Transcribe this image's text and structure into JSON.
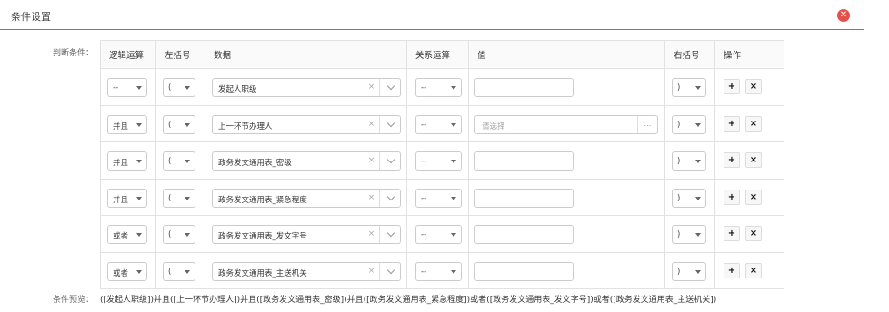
{
  "header": {
    "title": "条件设置",
    "close_icon": "✕"
  },
  "condition_label": "判断条件：",
  "columns": [
    "逻辑运算",
    "左括号",
    "数据",
    "关系运算",
    "值",
    "右括号",
    "操作"
  ],
  "rows": [
    {
      "logic": "--",
      "lparen": "(",
      "data": "发起人职级",
      "relation": "--",
      "value_type": "text",
      "value": "",
      "rparen": ")"
    },
    {
      "logic": "并且",
      "lparen": "(",
      "data": "上一环节办理人",
      "relation": "--",
      "value_type": "picker",
      "value": "请选择",
      "rparen": ")"
    },
    {
      "logic": "并且",
      "lparen": "(",
      "data": "政务发文通用表_密级",
      "relation": "--",
      "value_type": "text",
      "value": "",
      "rparen": ")"
    },
    {
      "logic": "并且",
      "lparen": "(",
      "data": "政务发文通用表_紧急程度",
      "relation": "--",
      "value_type": "text",
      "value": "",
      "rparen": ")"
    },
    {
      "logic": "或者",
      "lparen": "(",
      "data": "政务发文通用表_发文字号",
      "relation": "--",
      "value_type": "text",
      "value": "",
      "rparen": ")"
    },
    {
      "logic": "或者",
      "lparen": "(",
      "data": "政务发文通用表_主送机关",
      "relation": "--",
      "value_type": "text",
      "value": "",
      "rparen": ")"
    }
  ],
  "icons": {
    "clear": "×",
    "add": "+",
    "remove": "×",
    "more": "..."
  },
  "preview": {
    "label": "条件预览：",
    "text": "([发起人职级])并且([上一环节办理人])并且([政务发文通用表_密级])并且([政务发文通用表_紧急程度])或者([政务发文通用表_发文字号])或者([政务发文通用表_主送机关])"
  },
  "colors": {
    "accent": "#e5504a",
    "border": "#e2e2e2"
  }
}
